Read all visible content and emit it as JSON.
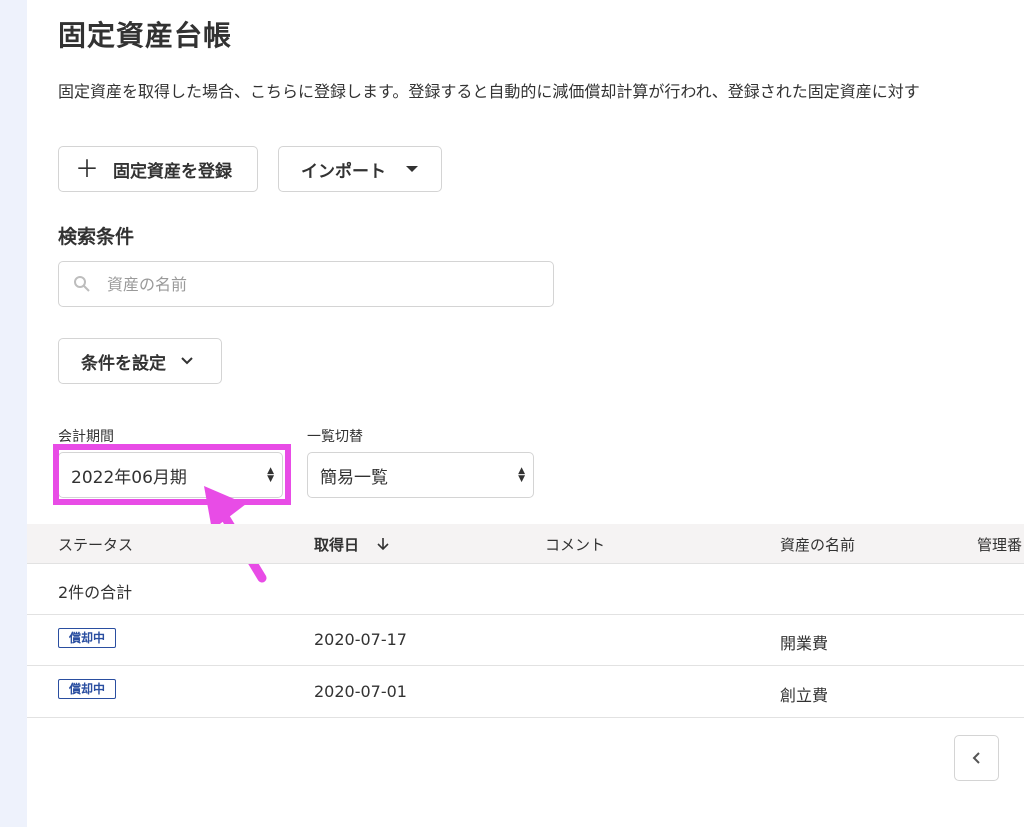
{
  "page": {
    "title": "固定資産台帳",
    "description": "固定資産を取得した場合、こちらに登録します。登録すると自動的に減価償却計算が行われ、登録された固定資産に対す"
  },
  "toolbar": {
    "register_label": "固定資産を登録",
    "import_label": "インポート"
  },
  "search": {
    "heading": "検索条件",
    "placeholder": "資産の名前",
    "conditions_label": "条件を設定"
  },
  "filters": {
    "period_label": "会計期間",
    "period_value": "2022年06月期",
    "view_label": "一覧切替",
    "view_value": "簡易一覧"
  },
  "table": {
    "headers": [
      "ステータス",
      "取得日",
      "コメント",
      "資産の名前",
      "管理番"
    ],
    "summary": "2件の合計",
    "rows": [
      {
        "status": "償却中",
        "date": "2020-07-17",
        "comment": "",
        "name": "開業費"
      },
      {
        "status": "償却中",
        "date": "2020-07-01",
        "comment": "",
        "name": "創立費"
      }
    ]
  },
  "colors": {
    "highlight": "#e84ce6",
    "badge": "#2a4ea0",
    "sidebar": "#eef2fc"
  }
}
